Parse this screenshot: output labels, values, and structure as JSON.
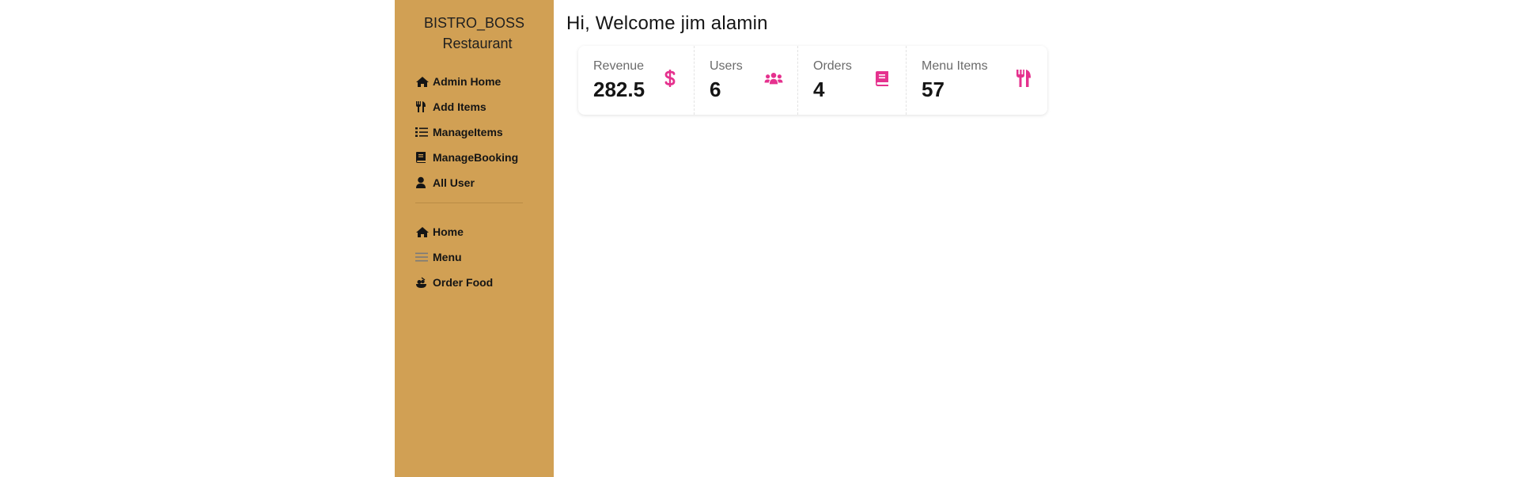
{
  "brand": {
    "line1": "BISTRO_BOSS",
    "line2": "Restaurant"
  },
  "sidebar": {
    "admin_items": [
      {
        "label": "Admin Home",
        "icon": "house-icon"
      },
      {
        "label": "Add Items",
        "icon": "utensils-icon"
      },
      {
        "label": "ManageItems",
        "icon": "list-icon"
      },
      {
        "label": "ManageBooking",
        "icon": "book-icon"
      },
      {
        "label": "All User",
        "icon": "user-icon"
      }
    ],
    "public_items": [
      {
        "label": "Home",
        "icon": "house-icon"
      },
      {
        "label": "Menu",
        "icon": "hamburger-menu-icon"
      },
      {
        "label": "Order Food",
        "icon": "food-bowl-icon"
      }
    ]
  },
  "main": {
    "greeting": "Hi, Welcome jim alamin"
  },
  "stats": [
    {
      "title": "Revenue",
      "value": "282.5",
      "icon": "dollar-icon"
    },
    {
      "title": "Users",
      "value": "6",
      "icon": "users-icon"
    },
    {
      "title": "Orders",
      "value": "4",
      "icon": "book-icon"
    },
    {
      "title": "Menu Items",
      "value": "57",
      "icon": "utensils-icon"
    }
  ],
  "colors": {
    "sidebar_bg": "#d1a054",
    "stat_icon": "#e5318e",
    "text": "#151515"
  }
}
